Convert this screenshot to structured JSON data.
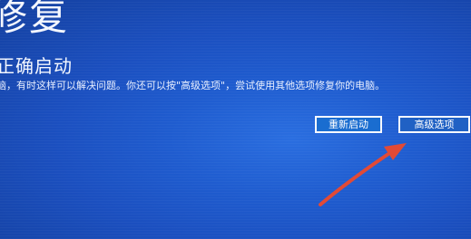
{
  "header": {
    "title": "修复"
  },
  "message": {
    "heading": "正确启动",
    "body": "脑，有时这样可以解决问题。你还可以按\"高级选项\"，尝试使用其他选项修复你的电脑。"
  },
  "buttons": {
    "restart_label": "重新启动",
    "advanced_label": "高级选项"
  },
  "colors": {
    "background": "#1f5ccf",
    "text": "#ffffff",
    "annotation_arrow": "#e24a36"
  },
  "icons": {
    "annotation": "red-arrow-icon"
  }
}
